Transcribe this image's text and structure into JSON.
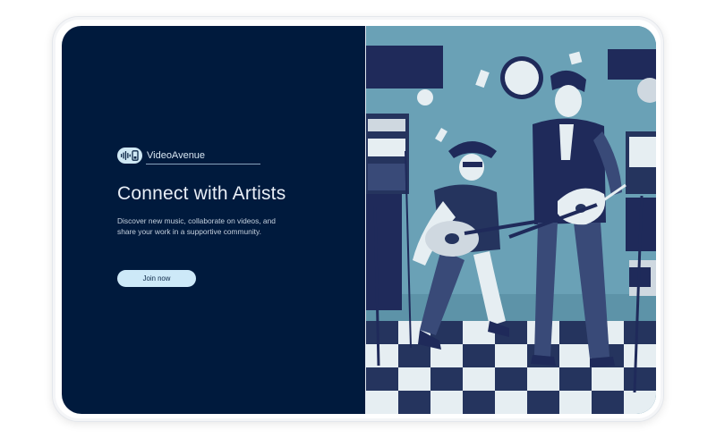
{
  "brand": {
    "name": "VideoAvenue",
    "logo_icon": "soundwave-phone-icon"
  },
  "hero": {
    "title": "Connect with Artists",
    "description": "Discover new music, collaborate on videos, and share your work in a supportive community."
  },
  "cta": {
    "join_label": "Join now"
  },
  "illustration": {
    "subject": "two-guitarists-on-stage-illustration"
  },
  "colors": {
    "panel": "#001a3d",
    "button": "#cde9f8",
    "art_teal": "#5d93a8",
    "art_navy": "#1f2a5a"
  }
}
